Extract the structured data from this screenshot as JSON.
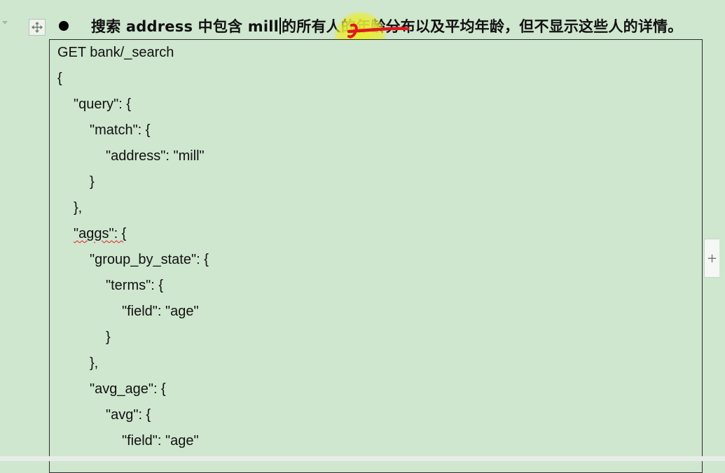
{
  "heading": {
    "before": "搜索 address 中包含 mill",
    "after": "的所有人的年龄分布以及平均年龄，但不显示这些人的详情。"
  },
  "code_lines": [
    "GET bank/_search",
    "{",
    "\"query\": {",
    "\"match\": {",
    "\"address\": \"mill\"",
    "}",
    "},",
    "\"aggs\": {",
    "\"group_by_state\": {",
    "\"terms\": {",
    "\"field\": \"age\"",
    "}",
    "},",
    "\"avg_age\": {",
    "\"avg\": {",
    "\"field\": \"age\""
  ],
  "icons": {
    "move_handle": "move-icon",
    "bullet": "bullet-icon",
    "add_handle": "plus-icon",
    "collapse": "chevron-down-icon"
  },
  "add_handle_label": "+",
  "colors": {
    "page_background": "#cfe6cf",
    "pointer_highlight": "#eaee28",
    "annotation_stroke": "#e0181e",
    "spellcheck": "#e02020"
  }
}
